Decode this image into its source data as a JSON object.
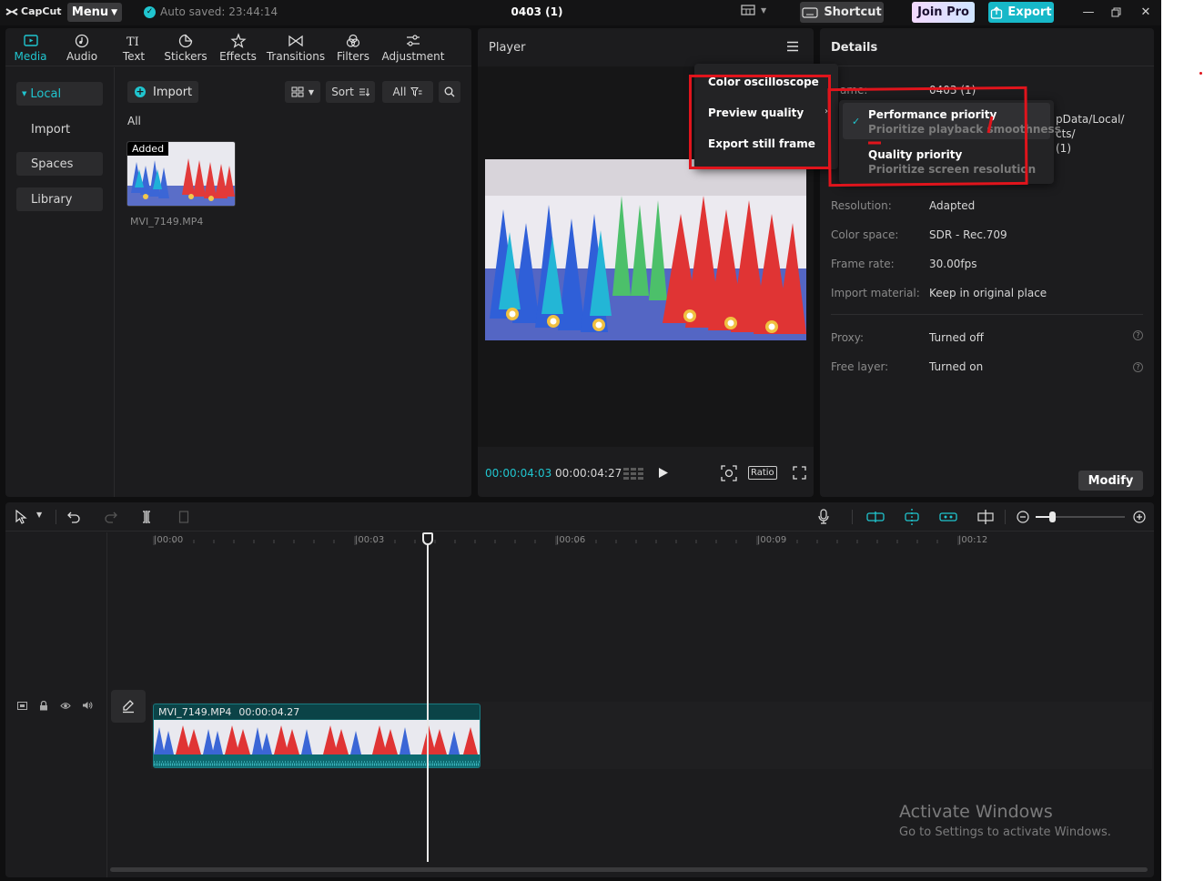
{
  "titlebar": {
    "logo_text": "CapCut",
    "menu_label": "Menu",
    "autosave_text": "Auto saved: 23:44:14",
    "project_title": "0403 (1)",
    "shortcut_label": "Shortcut",
    "joinpro_label": "Join Pro",
    "export_label": "Export"
  },
  "media_tabs": [
    {
      "label": "Media",
      "icon": "media-icon",
      "active": true
    },
    {
      "label": "Audio",
      "icon": "audio-icon"
    },
    {
      "label": "Text",
      "icon": "text-icon"
    },
    {
      "label": "Stickers",
      "icon": "stickers-icon"
    },
    {
      "label": "Effects",
      "icon": "effects-icon"
    },
    {
      "label": "Transitions",
      "icon": "transitions-icon"
    },
    {
      "label": "Filters",
      "icon": "filters-icon"
    },
    {
      "label": "Adjustment",
      "icon": "adjustment-icon"
    }
  ],
  "side_nav": [
    {
      "label": "Local",
      "active": true
    },
    {
      "label": "Import"
    },
    {
      "label": "Spaces"
    },
    {
      "label": "Library"
    }
  ],
  "media": {
    "import_label": "Import",
    "sort_label": "Sort",
    "filter_label": "All",
    "all_label": "All",
    "thumb_badge": "Added",
    "thumb_name": "MVI_7149.MP4"
  },
  "player": {
    "title": "Player",
    "timecode_current": "00:00:04:03",
    "timecode_total": "00:00:04:27",
    "ratio_label": "Ratio"
  },
  "details": {
    "title": "Details",
    "partial_name_label": "ame:",
    "partial_name_value": "0403 (1)",
    "partial_path_lines": [
      "pData/Local/",
      "cts/",
      "(1)"
    ],
    "rows": [
      {
        "key": "Resolution:",
        "value": "Adapted"
      },
      {
        "key": "Color space:",
        "value": "SDR - Rec.709"
      },
      {
        "key": "Frame rate:",
        "value": "30.00fps"
      },
      {
        "key": "Import material:",
        "value": "Keep in original place"
      },
      {
        "key": "Proxy:",
        "value": "Turned off"
      },
      {
        "key": "Free layer:",
        "value": "Turned on"
      }
    ],
    "modify_label": "Modify"
  },
  "player_menu": {
    "items": [
      "Color oscilloscope",
      "Preview quality",
      "Export still frame"
    ]
  },
  "quality_submenu": {
    "items": [
      {
        "title": "Performance priority",
        "desc": "Prioritize playback smoothness",
        "selected": true
      },
      {
        "title": "Quality priority",
        "desc": "Prioritize screen resolution"
      }
    ]
  },
  "timeline": {
    "ruler": [
      "|00:00",
      "|00:03",
      "|00:06",
      "|00:09",
      "|00:12"
    ],
    "clip_name": "MVI_7149.MP4",
    "clip_duration": "00:00:04.27"
  },
  "watermark": {
    "title": "Activate Windows",
    "subtitle": "Go to Settings to activate Windows."
  },
  "colors": {
    "accent": "#20c5cf",
    "annotation": "#e0141c"
  }
}
